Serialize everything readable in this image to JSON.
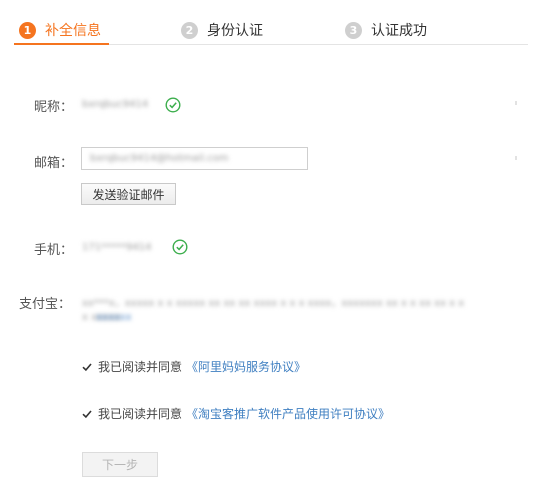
{
  "steps": [
    {
      "number": "1",
      "label": "补全信息",
      "state": "active"
    },
    {
      "number": "2",
      "label": "身份认证",
      "state": "inactive"
    },
    {
      "number": "3",
      "label": "认证成功",
      "state": "inactive"
    }
  ],
  "colors": {
    "accent": "#f5741f",
    "link": "#3f7fc1",
    "success": "#3cae4d"
  },
  "form": {
    "nickname": {
      "label": "昵称：",
      "value": "bxrqbuc9414",
      "verified_icon": "check-circle-icon"
    },
    "email": {
      "label": "邮箱：",
      "value": "bxrqbuc9414@hotmail.com",
      "send_button": "发送验证邮件"
    },
    "phone": {
      "label": "手机：",
      "value": "171*****9414",
      "verified_icon": "check-circle-icon"
    },
    "alipay": {
      "label": "支付宝：",
      "line1": "xx***x，xxxxx x x xxxxx xx xx xx xxxx x x x xxxx，xxxxxxx xx x x xx xx x x",
      "line2": "x xxxxx"
    }
  },
  "agreements": [
    {
      "text": "我已阅读并同意",
      "link": "《阿里妈妈服务协议》",
      "checked": true
    },
    {
      "text": "我已阅读并同意",
      "link": "《淘宝客推广软件产品使用许可协议》",
      "checked": true
    }
  ],
  "next_button": "下一步"
}
